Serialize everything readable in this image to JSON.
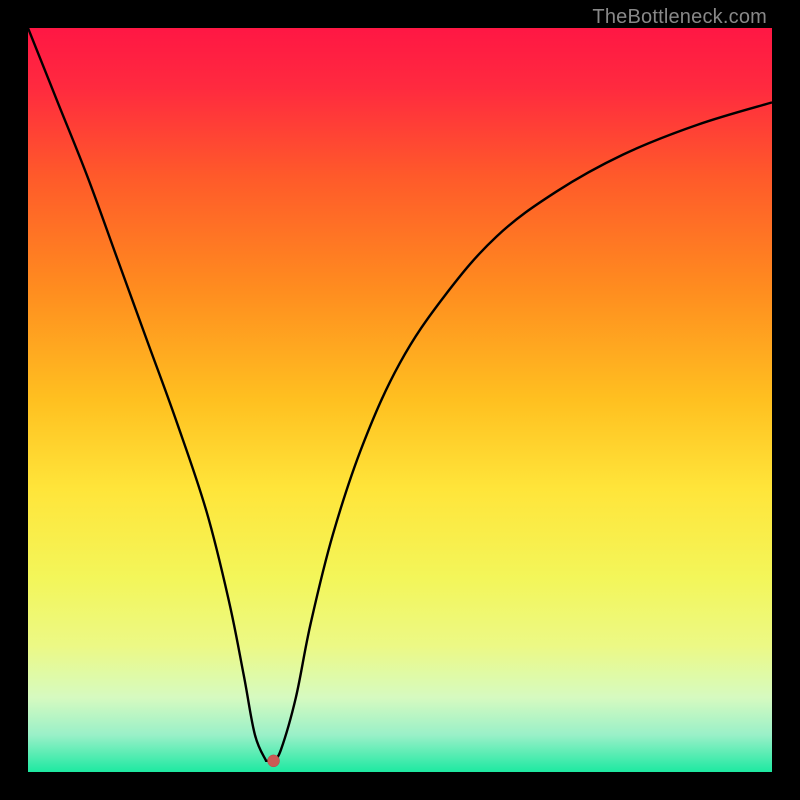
{
  "watermark": "TheBottleneck.com",
  "chart_data": {
    "type": "line",
    "title": "",
    "xlabel": "",
    "ylabel": "",
    "xlim": [
      0,
      100
    ],
    "ylim": [
      0,
      100
    ],
    "grid": false,
    "legend": false,
    "series": [
      {
        "name": "bottleneck-curve",
        "x": [
          0,
          4,
          8,
          12,
          16,
          20,
          24,
          27,
          29,
          30.5,
          32,
          33,
          34,
          36,
          38,
          41,
          45,
          50,
          56,
          63,
          71,
          80,
          90,
          100
        ],
        "y": [
          100,
          90,
          80,
          69,
          58,
          47,
          35,
          23,
          13,
          5,
          1.5,
          1.5,
          3,
          10,
          20,
          32,
          44,
          55,
          64,
          72,
          78,
          83,
          87,
          90
        ]
      }
    ],
    "marker": {
      "x": 33,
      "y": 1.5
    },
    "background": {
      "type": "vertical-gradient",
      "stops": [
        {
          "pos": 0.0,
          "color": "#ff1744"
        },
        {
          "pos": 0.08,
          "color": "#ff2a3f"
        },
        {
          "pos": 0.2,
          "color": "#ff5a2a"
        },
        {
          "pos": 0.35,
          "color": "#ff8c1f"
        },
        {
          "pos": 0.5,
          "color": "#ffc020"
        },
        {
          "pos": 0.62,
          "color": "#ffe53a"
        },
        {
          "pos": 0.74,
          "color": "#f3f65a"
        },
        {
          "pos": 0.83,
          "color": "#ecf985"
        },
        {
          "pos": 0.9,
          "color": "#d6fac0"
        },
        {
          "pos": 0.95,
          "color": "#9af0c8"
        },
        {
          "pos": 1.0,
          "color": "#1de9a1"
        }
      ]
    }
  }
}
